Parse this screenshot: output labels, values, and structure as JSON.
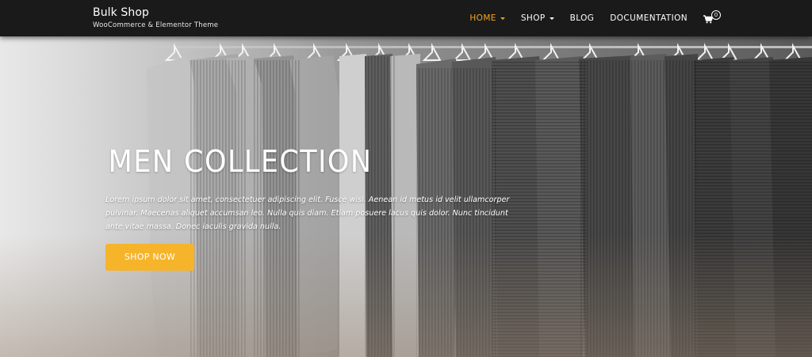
{
  "header": {
    "brand_title": "Bulk Shop",
    "brand_tagline": "WooCommerce & Elementor Theme",
    "nav": [
      {
        "label": "HOME",
        "has_dropdown": true,
        "active": true
      },
      {
        "label": "SHOP",
        "has_dropdown": true,
        "active": false
      },
      {
        "label": "BLOG",
        "has_dropdown": false,
        "active": false
      },
      {
        "label": "DOCUMENTATION",
        "has_dropdown": false,
        "active": false
      }
    ],
    "cart_icon": "shopping-cart-icon",
    "cart_count": "0"
  },
  "hero": {
    "title": "MEN COLLECTION",
    "text": "Lorem ipsum dolor sit amet, consectetuer adipiscing elit. Fusce wisi. Aenean id metus id velit ullamcorper pulvinar. Maecenas aliquet accumsan leo. Nulla quis diam. Etiam posuere lacus quis dolor. Nunc tincidunt ante vitae massa. Donec iaculis gravida nulla.",
    "button_label": "SHOP NOW"
  },
  "colors": {
    "header_bg": "#1a1a1a",
    "accent": "#f5a623",
    "button_bg": "#f6b42a"
  }
}
